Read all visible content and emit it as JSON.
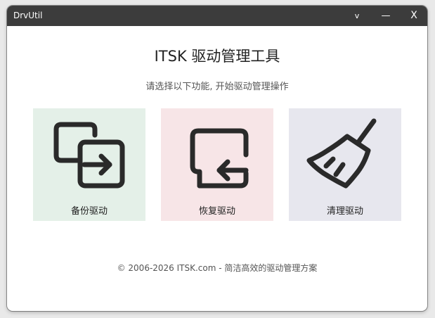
{
  "window": {
    "app_title": "DrvUtil",
    "menu_label": "v",
    "minimize_label": "—",
    "close_label": "X"
  },
  "main": {
    "heading": "ITSK 驱动管理工具",
    "subheading": "请选择以下功能, 开始驱动管理操作",
    "cards": [
      {
        "label": "备份驱动",
        "icon": "backup-export-icon",
        "bg": "#e4f0e8"
      },
      {
        "label": "恢复驱动",
        "icon": "restore-import-icon",
        "bg": "#f7e5e7"
      },
      {
        "label": "清理驱动",
        "icon": "broom-icon",
        "bg": "#e7e7ee"
      }
    ]
  },
  "footer": {
    "text": "© 2006-2026 ITSK.com - 简洁高效的驱动管理方案"
  },
  "colors": {
    "titlebar": "#3c3c3c",
    "icon_stroke": "#2a2a2a"
  }
}
